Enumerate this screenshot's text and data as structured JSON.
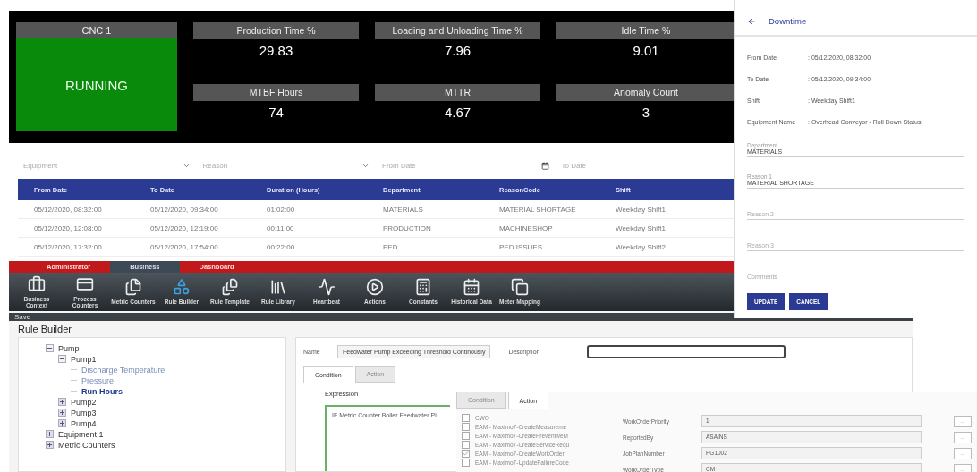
{
  "dashboard": {
    "machine": {
      "name": "CNC 1",
      "status": "RUNNING"
    },
    "metrics": [
      {
        "label": "Production Time %",
        "value": "29.83"
      },
      {
        "label": "Loading and Unloading Time %",
        "value": "7.96"
      },
      {
        "label": "Idle Time %",
        "value": "9.01"
      },
      {
        "label": "MTBF Hours",
        "value": "74"
      },
      {
        "label": "MTTR",
        "value": "4.67"
      },
      {
        "label": "Anomaly Count",
        "value": "3"
      }
    ]
  },
  "downtime_table": {
    "filters": [
      {
        "placeholder": "Equipment",
        "kind": "dropdown"
      },
      {
        "placeholder": "Reason",
        "kind": "dropdown"
      },
      {
        "placeholder": "From Date",
        "kind": "date"
      },
      {
        "placeholder": "To Date",
        "kind": "text"
      }
    ],
    "columns": [
      "From Date",
      "To Date",
      "Duration (Hours)",
      "Department",
      "ReasonCode",
      "Shift"
    ],
    "rows": [
      [
        "05/12/2020, 08:32:00",
        "05/12/2020, 09:34:00",
        "01:02:00",
        "MATERIALS",
        "MATERIAL SHORTAGE",
        "Weekday Shift1"
      ],
      [
        "05/12/2020, 12:08:00",
        "05/12/2020, 12:19:00",
        "00:11:00",
        "PRODUCTION",
        "MACHINESHOP",
        "Weekday Shift1"
      ],
      [
        "05/12/2020, 17:32:00",
        "05/12/2020, 17:54:00",
        "00:22:00",
        "PED",
        "PED ISSUES",
        "Weekday Shift2"
      ]
    ]
  },
  "downtime_form": {
    "title": "Downtime",
    "details": [
      {
        "label": "From Date",
        "value": ": 05/12/2020, 08:32:00"
      },
      {
        "label": "To Date",
        "value": ": 05/12/2020, 09:34:00"
      },
      {
        "label": "Shift",
        "value": ": Weekday Shift1"
      },
      {
        "label": "Equipment Name",
        "value": ": Overhead Conveyor - Roll Down Status"
      }
    ],
    "fields": [
      {
        "label": "Department",
        "value": "MATERIALS"
      },
      {
        "label": "Reason 1",
        "value": "MATERIAL SHORTAGE"
      },
      {
        "placeholder": "Reason 2"
      },
      {
        "placeholder": "Reason 3"
      },
      {
        "placeholder": "Comments"
      }
    ],
    "buttons": [
      "UPDATE",
      "CANCEL"
    ]
  },
  "rule_engine": {
    "tabs": [
      {
        "label": "Administrator",
        "selected": false
      },
      {
        "label": "Business",
        "selected": true
      },
      {
        "label": "Dashboard",
        "selected": false
      }
    ],
    "toolbar": [
      "Business Context",
      "Process Counters",
      "Metric Counters",
      "Rule Builder",
      "Rule Template",
      "Rule Library",
      "Heartbeat",
      "Actions",
      "Constants",
      "Historical Data",
      "Meter Mapping"
    ],
    "save_label": "Save",
    "title": "Rule Builder",
    "tree": [
      {
        "label": "Pump",
        "expanded": true,
        "selected": false,
        "children": [
          {
            "label": "Pump1",
            "expanded": true,
            "selected": false,
            "children": [
              {
                "label": "Discharge Temperature",
                "selected": false
              },
              {
                "label": "Pressure",
                "selected": false
              },
              {
                "label": "Run Hours",
                "selected": true
              }
            ]
          },
          {
            "label": "Pump2",
            "expanded": false,
            "selected": false
          },
          {
            "label": "Pump3",
            "expanded": false,
            "selected": false
          },
          {
            "label": "Pump4",
            "expanded": false,
            "selected": false
          }
        ]
      },
      {
        "label": "Equipment 1",
        "expanded": false,
        "selected": false
      },
      {
        "label": "Metric Counters",
        "expanded": false,
        "selected": false
      }
    ],
    "name_label": "Name",
    "name_value": "Feedwater Pump Exceeding Threshold Continously",
    "description_label": "Description",
    "editor_tabs": [
      {
        "label": "Condition",
        "selected": true
      },
      {
        "label": "Action",
        "selected": false
      }
    ],
    "expression_label": "Expression",
    "expression": "IF Metric Counter.Boiler Feedwater Pi",
    "action_panel": {
      "tabs": [
        {
          "label": "Condition",
          "selected": false
        },
        {
          "label": "Action",
          "selected": true
        }
      ],
      "actions": [
        {
          "label": "CWO",
          "checked": false
        },
        {
          "label": "EAM - Maximo7-CreateMeasureme",
          "checked": false
        },
        {
          "label": "EAM - Maximo7-CreatePreventiveM",
          "checked": false
        },
        {
          "label": "EAM - Maximo7-CreateServiceRequ",
          "checked": false
        },
        {
          "label": "EAM - Maximo7-CreateWorkOrder",
          "checked": true
        },
        {
          "label": "EAM - Maximo7-UpdateFailureCode",
          "checked": false
        }
      ],
      "parameters": [
        {
          "label": "WorkOrderPriority",
          "value": "1",
          "button": "..."
        },
        {
          "label": "ReportedBy",
          "value": "ASAINS",
          "button": "..."
        },
        {
          "label": "JobPlanNumber",
          "value": "PG1002",
          "button": "..."
        },
        {
          "label": "WorkOrderType",
          "value": "CM",
          "button": "..."
        }
      ]
    }
  }
}
